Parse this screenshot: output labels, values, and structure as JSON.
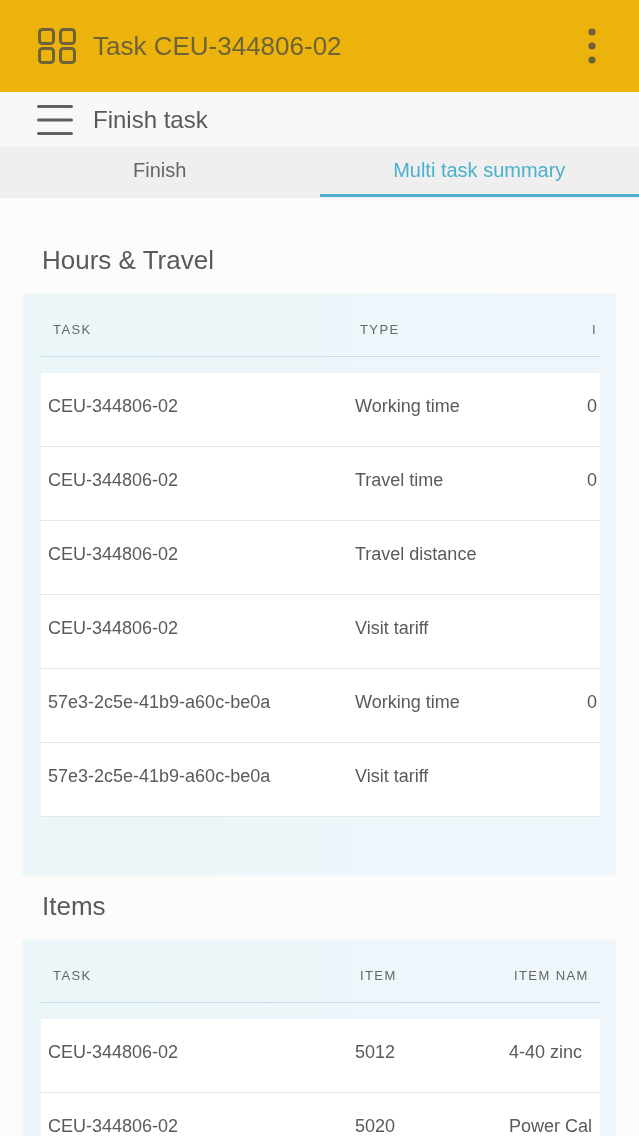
{
  "app_bar": {
    "title": "Task CEU-344806-02"
  },
  "sub_header": {
    "title": "Finish task"
  },
  "tabs": [
    {
      "label": "Finish",
      "selected": false
    },
    {
      "label": "Multi task summary",
      "selected": true
    }
  ],
  "sections": [
    {
      "title": "Hours & Travel",
      "table": {
        "columns": [
          "TASK",
          "TYPE",
          "I"
        ],
        "rows": [
          [
            "CEU-344806-02",
            "Working time",
            "0"
          ],
          [
            "CEU-344806-02",
            "Travel time",
            "0"
          ],
          [
            "CEU-344806-02",
            "Travel distance",
            ""
          ],
          [
            "CEU-344806-02",
            "Visit tariff",
            ""
          ],
          [
            "57e3-2c5e-41b9-a60c-be0a",
            "Working time",
            "0"
          ],
          [
            "57e3-2c5e-41b9-a60c-be0a",
            "Visit tariff",
            ""
          ]
        ]
      }
    },
    {
      "title": "Items",
      "table": {
        "columns": [
          "TASK",
          "ITEM",
          "ITEM NAM"
        ],
        "rows": [
          [
            "CEU-344806-02",
            "5012",
            "4-40 zinc"
          ],
          [
            "CEU-344806-02",
            "5020",
            "Power Cal"
          ]
        ]
      }
    }
  ]
}
